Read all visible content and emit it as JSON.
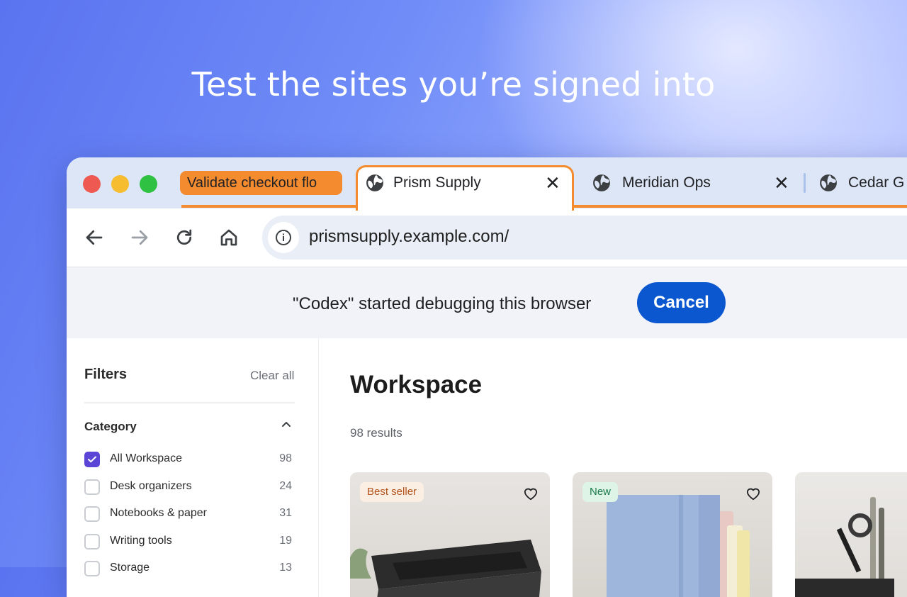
{
  "headline": "Test the sites you’re signed into",
  "tabs": {
    "group_label": "Validate checkout flo",
    "items": [
      {
        "title": "Prism Supply",
        "close": "✕"
      },
      {
        "title": "Meridian Ops",
        "close": "✕"
      },
      {
        "title": "Cedar G"
      }
    ]
  },
  "toolbar": {
    "url": "prismsupply.example.com/"
  },
  "infobar": {
    "message": "\"Codex\" started debugging this browser",
    "cancel_label": "Cancel"
  },
  "sidebar": {
    "title": "Filters",
    "clear_all": "Clear all",
    "category_title": "Category",
    "filters": [
      {
        "label": "All Workspace",
        "count": "98",
        "checked": true
      },
      {
        "label": "Desk organizers",
        "count": "24",
        "checked": false
      },
      {
        "label": "Notebooks & paper",
        "count": "31",
        "checked": false
      },
      {
        "label": "Writing tools",
        "count": "19",
        "checked": false
      },
      {
        "label": "Storage",
        "count": "13",
        "checked": false
      }
    ]
  },
  "main": {
    "title": "Workspace",
    "results": "98 results",
    "cards": [
      {
        "badge": "Best seller",
        "badge_color": "#b4541a",
        "badge_bg": "#fbeee3"
      },
      {
        "badge": "New",
        "badge_color": "#1b7a4b",
        "badge_bg": "#def4e7"
      },
      {
        "badge": ""
      }
    ]
  },
  "colors": {
    "tab_group": "#f48b2e",
    "accent": "#0b57d0",
    "checkbox": "#5a45d6"
  }
}
